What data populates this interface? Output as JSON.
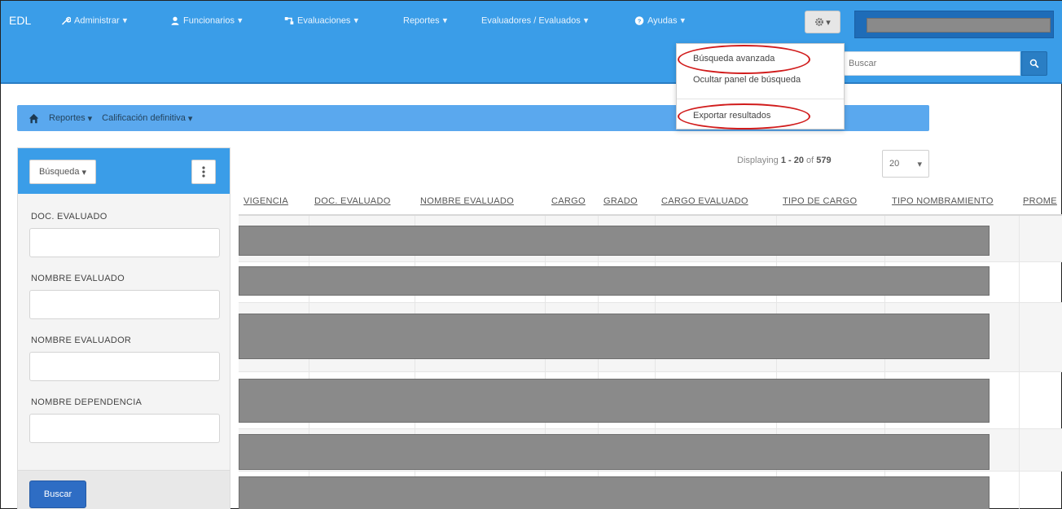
{
  "nav": {
    "brand": "EDL",
    "items": [
      {
        "label": "Administrar",
        "icon": "wrench-icon"
      },
      {
        "label": "Funcionarios",
        "icon": "user-icon"
      },
      {
        "label": "Evaluaciones",
        "icon": "flow-icon"
      },
      {
        "label": "Reportes",
        "icon": ""
      },
      {
        "label": "Evaluadores / Evaluados",
        "icon": ""
      },
      {
        "label": "Ayudas",
        "icon": "question-circle-icon"
      }
    ],
    "caret": "▾",
    "gear_icon": "gear-icon"
  },
  "search": {
    "placeholder": "Buscar"
  },
  "breadcrumb": {
    "home_icon": "home-icon",
    "items": [
      "Reportes",
      "Calificación definitiva"
    ]
  },
  "dropdown": {
    "items": [
      "Búsqueda avanzada",
      "Ocultar panel de búsqueda",
      "Exportar resultados"
    ]
  },
  "panel": {
    "busqueda_label": "Búsqueda",
    "fields": [
      "DOC. EVALUADO",
      "NOMBRE EVALUADO",
      "NOMBRE EVALUADOR",
      "NOMBRE DEPENDENCIA"
    ],
    "buscar_label": "Buscar"
  },
  "results": {
    "displaying_prefix": "Displaying",
    "range": "1 - 20",
    "of_label": "of",
    "total": "579",
    "page_size": "20"
  },
  "table": {
    "columns": [
      "VIGENCIA",
      "DOC. EVALUADO",
      "NOMBRE EVALUADO",
      "CARGO",
      "GRADO",
      "CARGO EVALUADO",
      "TIPO DE CARGO",
      "TIPO NOMBRAMIENTO",
      "PROME"
    ]
  },
  "colors": {
    "nav_bg": "#3a9de8",
    "breadcrumb_bg": "#5aa8ee",
    "buscar_btn": "#2e6dc4",
    "highlight_oval": "#d11c1c",
    "redaction": "#8a8a8a"
  }
}
